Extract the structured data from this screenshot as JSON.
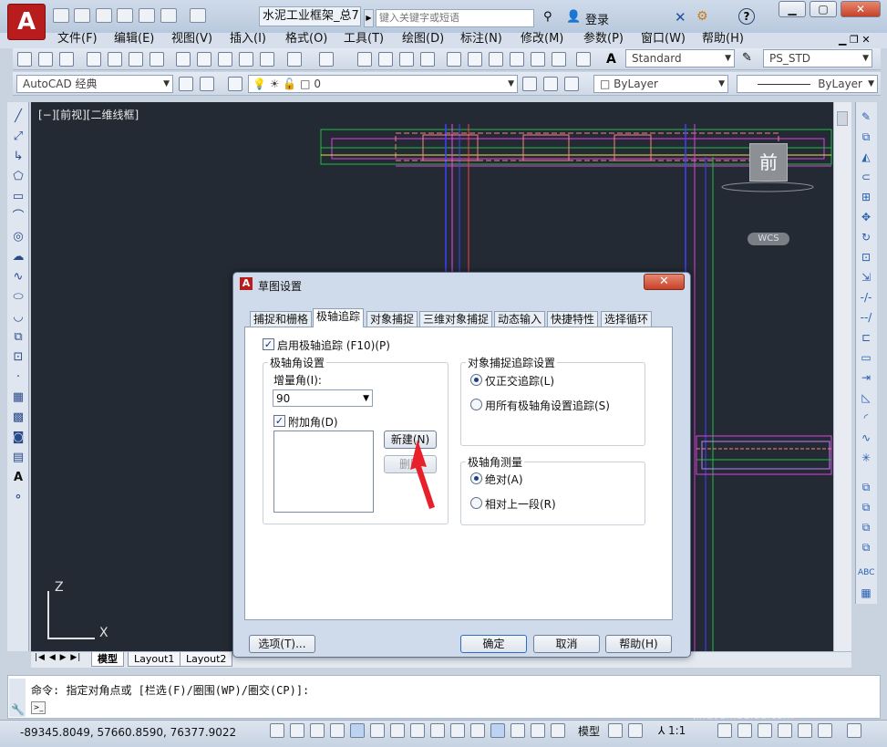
{
  "app": {
    "logo": "A",
    "doc_title": "水泥工业框架_总7...",
    "search_placeholder": "键入关键字或短语",
    "login": "登录"
  },
  "menu": [
    "文件(F)",
    "编辑(E)",
    "视图(V)",
    "插入(I)",
    "格式(O)",
    "工具(T)",
    "绘图(D)",
    "标注(N)",
    "修改(M)",
    "参数(P)",
    "窗口(W)",
    "帮助(H)"
  ],
  "toolbar": {
    "text_style": "Standard",
    "plot_style": "PS_STD",
    "workspace": "AutoCAD 经典",
    "layer": "0",
    "color": "ByLayer",
    "linetype": "ByLayer"
  },
  "viewport": {
    "label": "[−][前视][二维线框]",
    "viewcube": "前",
    "wcs": "WCS",
    "axis_x": "X",
    "axis_z": "Z"
  },
  "layout_tabs": [
    "模型",
    "Layout1",
    "Layout2"
  ],
  "command": {
    "line": "命令: 指定对角点或 [栏选(F)/圈围(WP)/圈交(CP)]:",
    "prompt": ">_"
  },
  "status": {
    "coords": "-89345.8049, 57660.8590, 76377.9022",
    "model": "模型",
    "scale": "1:1"
  },
  "watermark": {
    "brand": "Baidu经验",
    "url": "jingyan.baidu.com"
  },
  "dialog": {
    "title": "草图设置",
    "tabs": [
      "捕捉和栅格",
      "极轴追踪",
      "对象捕捉",
      "三维对象捕捉",
      "动态输入",
      "快捷特性",
      "选择循环"
    ],
    "active_tab": "极轴追踪",
    "enable_polar": {
      "label": "启用极轴追踪 (F10)(P)",
      "checked": true
    },
    "polar_angle": {
      "group": "极轴角设置",
      "increment_label": "增量角(I):",
      "increment_value": "90",
      "additional_label": "附加角(D)",
      "additional_checked": true,
      "new_btn": "新建(N)",
      "delete_btn": "删除"
    },
    "snap_tracking": {
      "group": "对象捕捉追踪设置",
      "option1": "仅正交追踪(L)",
      "option2": "用所有极轴角设置追踪(S)",
      "selected": 1
    },
    "measure": {
      "group": "极轴角测量",
      "option1": "绝对(A)",
      "option2": "相对上一段(R)",
      "selected": 1
    },
    "buttons": {
      "options": "选项(T)...",
      "ok": "确定",
      "cancel": "取消",
      "help": "帮助(H)"
    }
  },
  "colors": {
    "canvas_bg": "#242a33",
    "accent_red": "#b91c1c",
    "dialog_bg": "#cfdbea"
  }
}
